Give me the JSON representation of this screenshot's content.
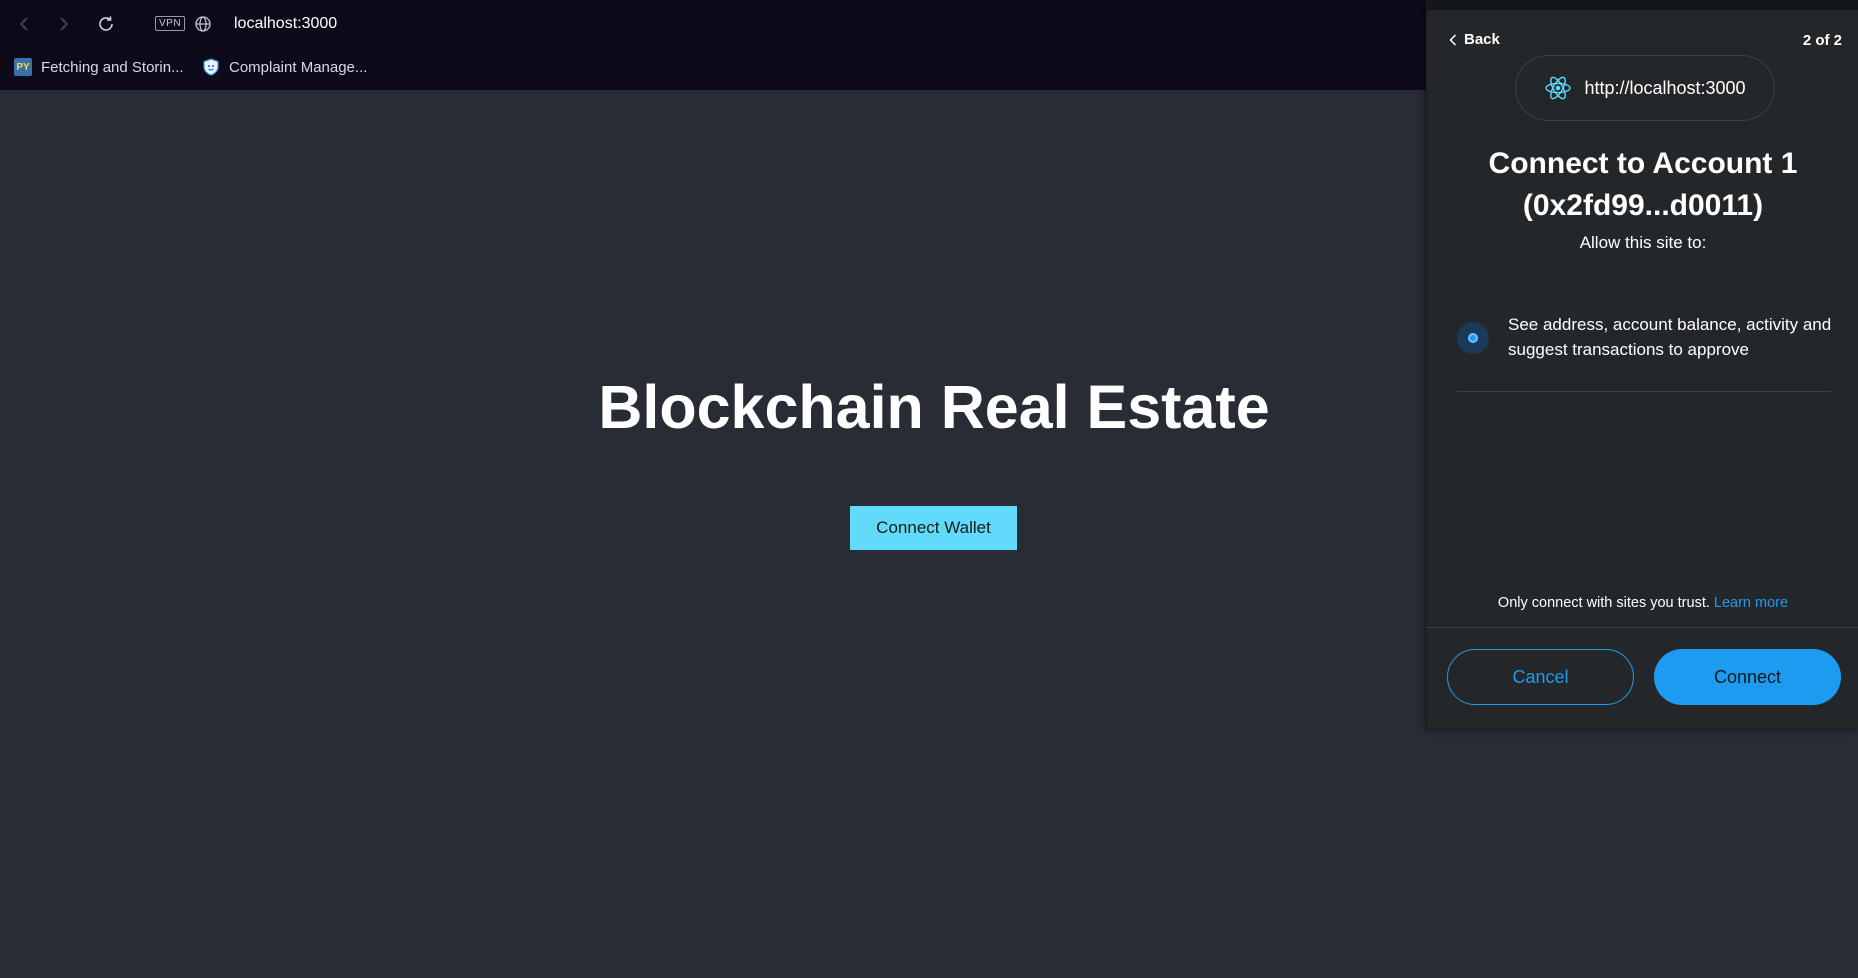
{
  "browser": {
    "url": "localhost:3000",
    "vpn_label": "VPN",
    "bookmarks": [
      {
        "icon_text": "PY",
        "label": "Fetching and Storin..."
      },
      {
        "label": "Complaint Manage..."
      }
    ]
  },
  "page": {
    "title": "Blockchain Real Estate",
    "connect_wallet_label": "Connect Wallet"
  },
  "popup": {
    "back_label": "Back",
    "step": "2 of 2",
    "site_url": "http://localhost:3000",
    "heading_line1": "Connect to Account 1",
    "heading_line2": "(0x2fd99...d0011)",
    "allow_text": "Allow this site to:",
    "permission_text": "See address, account balance, activity and suggest transactions to approve",
    "trust_text": "Only connect with sites you trust.",
    "learn_more": "Learn more",
    "cancel_label": "Cancel",
    "connect_label": "Connect"
  },
  "colors": {
    "page_bg": "#282c34",
    "chrome_bg": "#0d0b1a",
    "popup_bg": "#24272a",
    "accent": "#1c9bf0",
    "wallet_button": "#61dafb"
  },
  "icons": [
    "back-arrow-icon",
    "forward-arrow-icon",
    "reload-icon",
    "globe-icon",
    "python-icon",
    "shield-icon",
    "chevron-left-icon",
    "react-logo-icon",
    "permission-dot-icon"
  ]
}
